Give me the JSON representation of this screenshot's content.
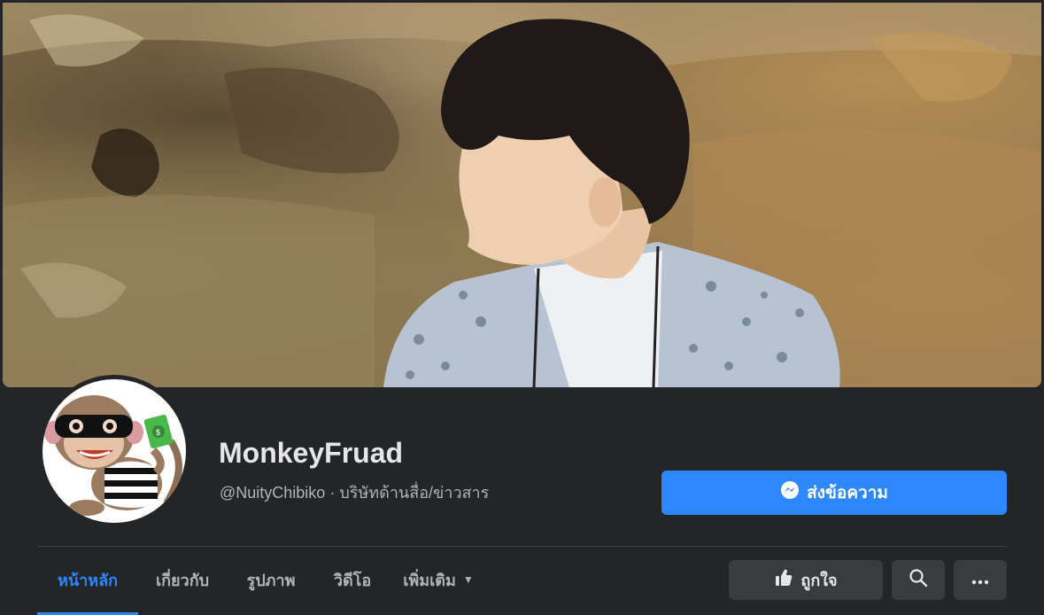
{
  "page": {
    "name": "MonkeyFruad",
    "handle": "@NuityChibiko",
    "separator": " · ",
    "category": "บริษัทด้านสื่อ/ข่าวสาร"
  },
  "actions": {
    "message_label": "ส่งข้อความ",
    "like_label": "ถูกใจ"
  },
  "tabs": [
    {
      "label": "หน้าหลัก",
      "active": true
    },
    {
      "label": "เกี่ยวกับ",
      "active": false
    },
    {
      "label": "รูปภาพ",
      "active": false
    },
    {
      "label": "วิดีโอ",
      "active": false
    },
    {
      "label": "เพิ่มเติม",
      "active": false
    }
  ],
  "colors": {
    "background": "#242526",
    "accent": "#2d88ff",
    "button_secondary": "#3a3b3c"
  },
  "icons": {
    "message": "messenger-icon",
    "like": "thumbs-up-icon",
    "search": "search-icon",
    "more": "more-dots-icon",
    "dropdown": "caret-down-icon"
  }
}
